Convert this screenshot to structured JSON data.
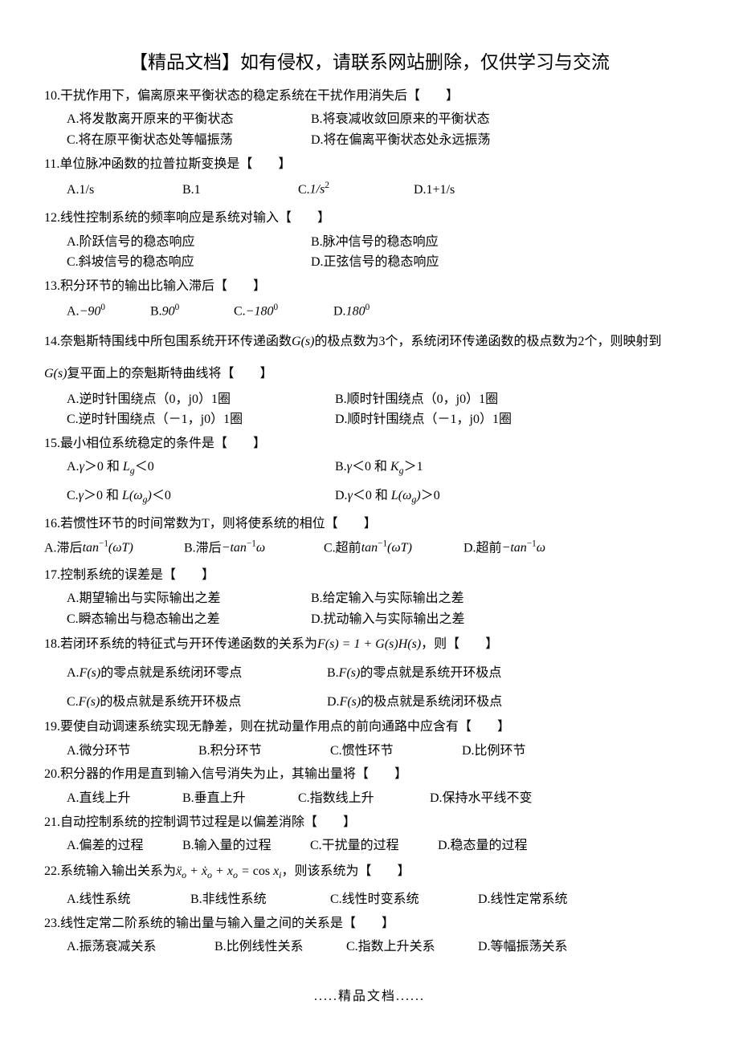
{
  "header": "【精品文档】如有侵权，请联系网站删除，仅供学习与交流",
  "q10": {
    "text": "10.干扰作用下，偏离原来平衡状态的稳定系统在干扰作用消失后【　　】",
    "a": "A.将发散离开原来的平衡状态",
    "b": "B.将衰减收敛回原来的平衡状态",
    "c": "C.将在原平衡状态处等幅振荡",
    "d": "D.将在偏离平衡状态处永远振荡"
  },
  "q11": {
    "text": "11.单位脉冲函数的拉普拉斯变换是【　　】",
    "a": "A.1/s",
    "b": "B.1",
    "c_pre": "C. ",
    "d": "D.1+1/s"
  },
  "q12": {
    "text": "12.线性控制系统的频率响应是系统对输入【　　】",
    "a": "A.阶跃信号的稳态响应",
    "b": "B.脉冲信号的稳态响应",
    "c": "C.斜坡信号的稳态响应",
    "d": "D.正弦信号的稳态响应"
  },
  "q13": {
    "text": "13.积分环节的输出比输入滞后【　　】"
  },
  "q14": {
    "pre": "14.奈魁斯特围线中所包围系统开环传递函数",
    "mid": "的极点数为3个，系统闭环传递函数的极点数为2个，则映射到",
    "post": "复平面上的奈魁斯特曲线将【　　】",
    "a": "A.逆时针围绕点（0，j0）1圈",
    "b": "B.顺时针围绕点（0，j0）1圈",
    "c": "C.逆时针围绕点（－1，j0）1圈",
    "d": "D.顺时针围绕点（－1，j0）1圈"
  },
  "q15": {
    "text": "15.最小相位系统稳定的条件是【　　】"
  },
  "q16": {
    "text": "16.若惯性环节的时间常数为T，则将使系统的相位【　　】"
  },
  "q17": {
    "text": "17.控制系统的误差是【　　】",
    "a": "A.期望输出与实际输出之差",
    "b": "B.给定输入与实际输出之差",
    "c": "C.瞬态输出与稳态输出之差",
    "d": "D.扰动输入与实际输出之差"
  },
  "q18": {
    "pre": "18.若闭环系统的特征式与开环传递函数的关系为",
    "post": "，则【　　】",
    "a_post": "的零点就是系统闭环零点",
    "b_post": "的零点就是系统开环极点",
    "c_post": "的极点就是系统开环极点",
    "d_post": "的极点就是系统闭环极点"
  },
  "q19": {
    "text": "19.要使自动调速系统实现无静差，则在扰动量作用点的前向通路中应含有【　　】",
    "a": "A.微分环节",
    "b": "B.积分环节",
    "c": "C.惯性环节",
    "d": "D.比例环节"
  },
  "q20": {
    "text": "20.积分器的作用是直到输入信号消失为止，其输出量将【　　】",
    "a": "A.直线上升",
    "b": "B.垂直上升",
    "c": "C.指数线上升",
    "d": "D.保持水平线不变"
  },
  "q21": {
    "text": "21.自动控制系统的控制调节过程是以偏差消除【　　】",
    "a": "A.偏差的过程",
    "b": "B.输入量的过程",
    "c": "C.干扰量的过程",
    "d": "D.稳态量的过程"
  },
  "q22": {
    "pre": "22.系统输入输出关系为",
    "post": "，则该系统为【　　】",
    "a": "A.线性系统",
    "b": "B.非线性系统",
    "c": "C.线性时变系统",
    "d": "D.线性定常系统"
  },
  "q23": {
    "text": "23.线性定常二阶系统的输出量与输入量之间的关系是【　　】",
    "a": "A.振荡衰减关系",
    "b": "B.比例线性关系",
    "c": "C.指数上升关系",
    "d": "D.等幅振荡关系"
  },
  "footer": ".....精品文档......"
}
